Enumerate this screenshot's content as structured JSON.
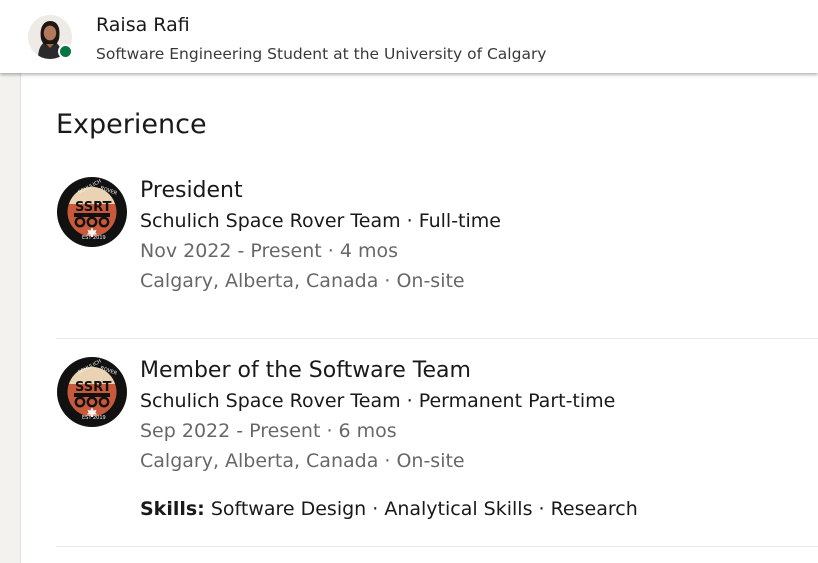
{
  "profile": {
    "name": "Raisa Rafi",
    "headline": "Software Engineering Student at the University of Calgary",
    "status": "online",
    "status_color": "#057642"
  },
  "experience": {
    "title": "Experience",
    "items": [
      {
        "logo": "ssrt-logo",
        "title": "President",
        "company": "Schulich Space Rover Team · Full-time",
        "dates": "Nov 2022 - Present · 4 mos",
        "location": "Calgary, Alberta, Canada · On-site"
      },
      {
        "logo": "ssrt-logo",
        "title": "Member of the Software Team",
        "company": "Schulich Space Rover Team · Permanent Part-time",
        "dates": "Sep 2022 - Present · 6 mos",
        "location": "Calgary, Alberta, Canada · On-site",
        "skills_label": "Skills:",
        "skills": "Software Design · Analytical Skills · Research"
      }
    ]
  }
}
